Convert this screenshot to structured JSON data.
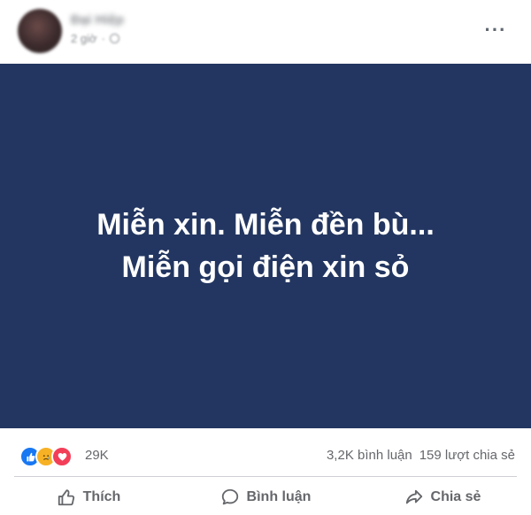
{
  "post": {
    "author": "Đại Hiệp",
    "time": "2 giờ",
    "status_lines": [
      "Miễn xin. Miễn đền bù...",
      "Miễn gọi điện xin sỏ"
    ],
    "background_color": "#233661"
  },
  "stats": {
    "reaction_icons": [
      "like-icon",
      "sad-icon",
      "love-icon"
    ],
    "reaction_count": "29K",
    "comments": "3,2K bình luận",
    "shares": "159 lượt chia sẻ"
  },
  "actions": {
    "like_label": "Thích",
    "comment_label": "Bình luận",
    "share_label": "Chia sẻ"
  },
  "colors": {
    "text_secondary": "#65676b",
    "like_blue": "#1877f2",
    "love_red": "#f33e58",
    "sad_yellow": "#f7b125"
  }
}
